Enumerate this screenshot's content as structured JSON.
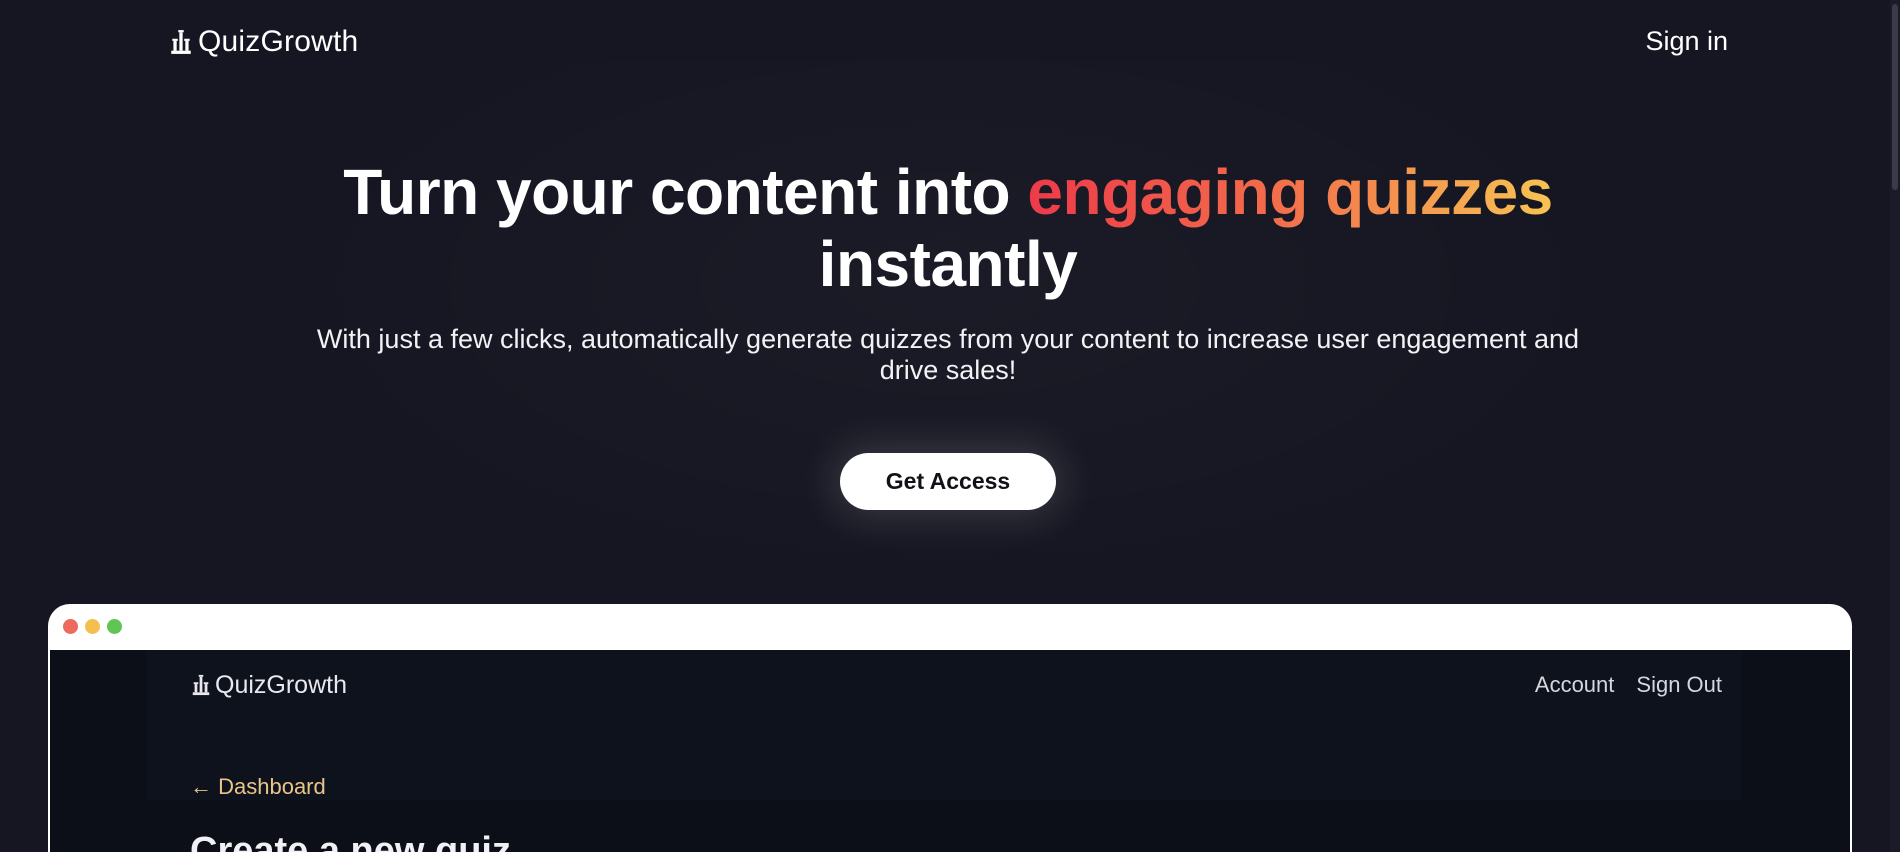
{
  "nav": {
    "logo_text": "QuizGrowth",
    "logo_icon": "castle-icon",
    "signin_label": "Sign in"
  },
  "hero": {
    "title_lead": "Turn your content into",
    "title_highlight": "engaging quizzes",
    "title_tail": "instantly",
    "subtitle": "With just a few clicks, automatically generate quizzes from your content to increase user engagement and drive sales!",
    "cta_label": "Get Access",
    "highlight_colors": [
      "#ee3a4a",
      "#f26a4b",
      "#f7c353"
    ]
  },
  "preview": {
    "window_dots": [
      "#ee6a5f",
      "#f5bf4f",
      "#61c554"
    ],
    "logo_text": "QuizGrowth",
    "account_label": "Account",
    "signout_label": "Sign Out",
    "back_label": "← Dashboard",
    "heading": "Create a new quiz"
  },
  "colors": {
    "background": "#161622",
    "accent_link": "#e9c58a"
  }
}
